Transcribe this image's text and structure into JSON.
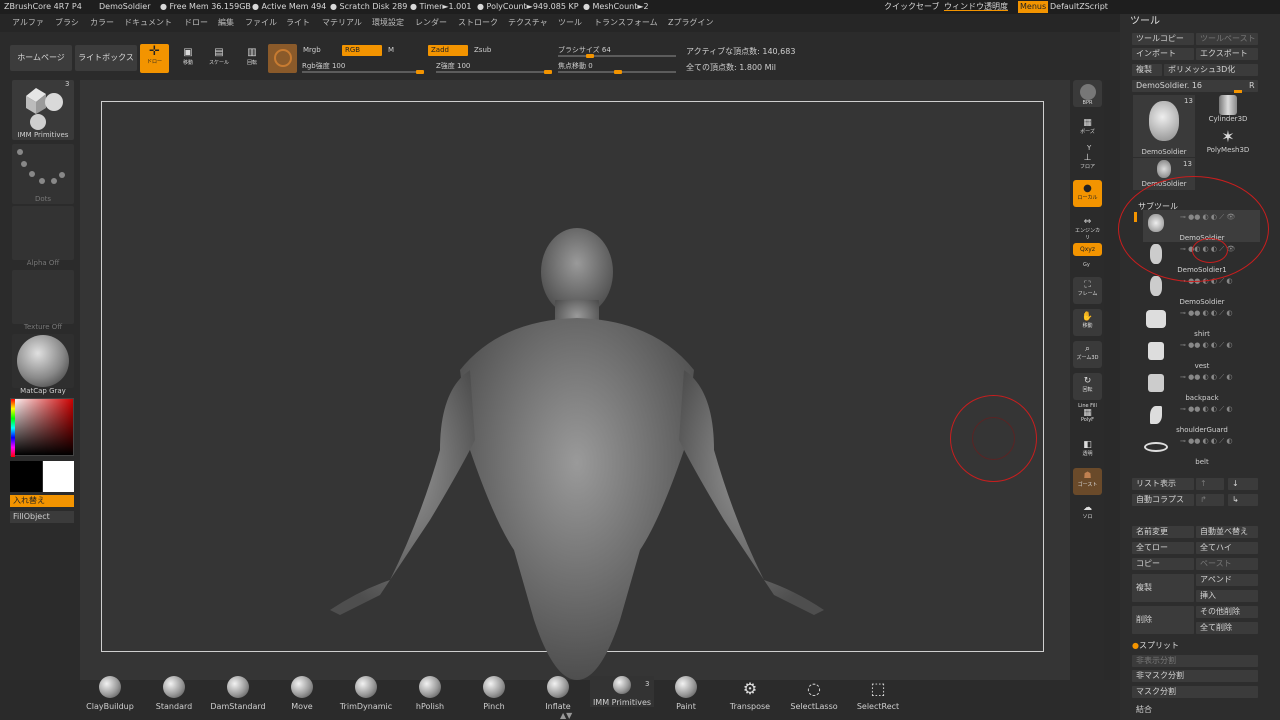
{
  "title_bar": {
    "app": "ZBrushCore 4R7 P4",
    "doc": "DemoSoldier",
    "free_mem": "● Free Mem 36.159GB",
    "active_mem": "● Active Mem 494",
    "scratch": "● Scratch Disk 289",
    "timer": "● Timer►1.001",
    "polycount": "● PolyCount►949.085 KP",
    "meshcount": "● MeshCount►2",
    "quicksave": "クイックセーブ",
    "transparency": "ウィンドウ透明度",
    "menus": "Menus",
    "script": "DefaultZScript"
  },
  "menu": [
    "アルファ",
    "ブラシ",
    "カラー",
    "ドキュメント",
    "ドロー",
    "編集",
    "ファイル",
    "ライト",
    "マテリアル",
    "環境設定",
    "レンダー",
    "ストローク",
    "テクスチャ",
    "ツール",
    "トランスフォーム",
    "Zプラグイン"
  ],
  "toolbar": {
    "home": "ホームページ",
    "lightbox": "ライトボックス",
    "draw": "ドロー",
    "move": "移動",
    "scale": "スケール",
    "rotate": "回転",
    "mrgb": "Mrgb",
    "rgb": "RGB",
    "m": "M",
    "zadd": "Zadd",
    "zsub": "Zsub",
    "rgb_intensity": "Rgb強度 100",
    "z_intensity": "Z強度 100",
    "brush_size": "ブラシサイズ 64",
    "focal_shift": "焦点移動 0",
    "active_points": "アクティブな頂点数: 140,683",
    "total_points": "全ての頂点数: 1.800 Mil"
  },
  "left_shelf": {
    "tool_count": "3",
    "primitives": "IMM Primitives",
    "dots": "Dots",
    "alpha": "Alpha Off",
    "texture": "Texture Off",
    "material": "MatCap Gray",
    "swap": "入れ替え",
    "fill": "FillObject"
  },
  "right_buttons": [
    "BPR",
    "ポーズ",
    "フロア",
    "ローカル",
    "エンジンカリ",
    "Qxyz",
    "フレーム",
    "移動",
    "ズーム3D",
    "回転",
    "Line Fill",
    "PolyF",
    "透明",
    "ゴースト",
    "ソロ"
  ],
  "right_small": {
    "y": "Y",
    "xyz_sub": "Gy"
  },
  "tool_panel": {
    "header": "ツール",
    "copy": "ツールコピー",
    "paste": "ツールペースト",
    "import": "インポート",
    "export": "エクスポート",
    "clone": "複製",
    "polymesh": "ポリメッシュ3D化",
    "current": "DemoSoldier. 16",
    "r": "R",
    "thumbs": [
      {
        "name": "DemoSoldier",
        "count": "13"
      },
      {
        "name": "Cylinder3D"
      },
      {
        "name": "PolyMesh3D"
      },
      {
        "name": "DemoSoldier",
        "count": "13"
      }
    ],
    "subtool_header": "サブツール",
    "subtools": [
      "DemoSoldier",
      "DemoSoldier1",
      "DemoSoldier",
      "shirt",
      "vest",
      "backpack",
      "shoulderGuard",
      "belt"
    ],
    "list_all": "リスト表示",
    "auto_collapse": "自動コラプス",
    "rename": "名前変更",
    "auto_reorder": "自動並べ替え",
    "all_low": "全てロー",
    "all_high": "全てハイ",
    "copy2": "コピー",
    "paste2": "ペースト",
    "duplicate": "複製",
    "append": "アペンド",
    "insert": "挿入",
    "delete": "削除",
    "del_other": "その他削除",
    "del_all": "全て削除",
    "split": "スプリット",
    "split_hidden": "非表示分割",
    "split_unmasked": "非マスク分割",
    "split_masked": "マスク分割",
    "merge": "結合"
  },
  "brushes": [
    {
      "name": "ClayBuildup"
    },
    {
      "name": "Standard"
    },
    {
      "name": "DamStandard"
    },
    {
      "name": "Move"
    },
    {
      "name": "TrimDynamic"
    },
    {
      "name": "hPolish"
    },
    {
      "name": "Pinch"
    },
    {
      "name": "Inflate"
    },
    {
      "name": "IMM Primitives",
      "count": "3"
    },
    {
      "name": "Paint"
    },
    {
      "name": "Transpose"
    },
    {
      "name": "SelectLasso"
    },
    {
      "name": "SelectRect"
    }
  ],
  "colors": {
    "accent": "#f39400",
    "annotation": "#c81e1e"
  }
}
